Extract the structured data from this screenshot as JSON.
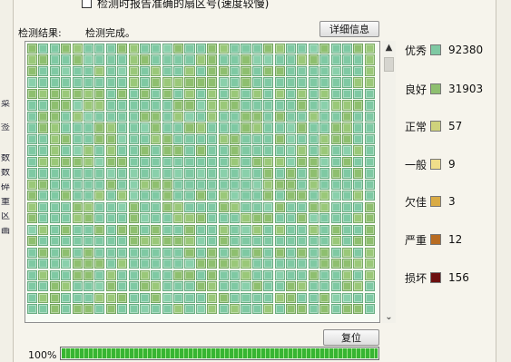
{
  "header": {
    "checkbox_label": "检测时报告准确的扇区号(速度较慢)"
  },
  "scan": {
    "result_label": "检测结果:",
    "status_text": "检测完成。",
    "details_button": "详细信息",
    "reset_button": "复位",
    "progress_text": "100%",
    "progress_value": 1.0
  },
  "legend": [
    {
      "label": "优秀",
      "count": "92380",
      "color": "#7fc9a3"
    },
    {
      "label": "良好",
      "count": "31903",
      "color": "#8ebf6f"
    },
    {
      "label": "正常",
      "count": "57",
      "color": "#cfd27c"
    },
    {
      "label": "一般",
      "count": "9",
      "color": "#f0de8a"
    },
    {
      "label": "欠佳",
      "count": "3",
      "color": "#d9ab45"
    },
    {
      "label": "严重",
      "count": "12",
      "color": "#b86c22"
    },
    {
      "label": "损坏",
      "count": "156",
      "color": "#6d1010"
    }
  ],
  "scrollbar": {
    "up_icon": "chevron-up-icon",
    "down_icon": "chevron-down-icon",
    "up_glyph": "▲",
    "down_glyph": "⌄"
  },
  "edge_text": {
    "left_fragments": [
      "菜",
      "签",
      "数",
      "数",
      "碎",
      "重",
      "区",
      "画"
    ]
  },
  "grid_palette": {
    "excellent": "#7fc9a3",
    "good": "#8ebf6f",
    "excellent_alt": "#8ad0ab",
    "good_alt": "#9ac879"
  }
}
